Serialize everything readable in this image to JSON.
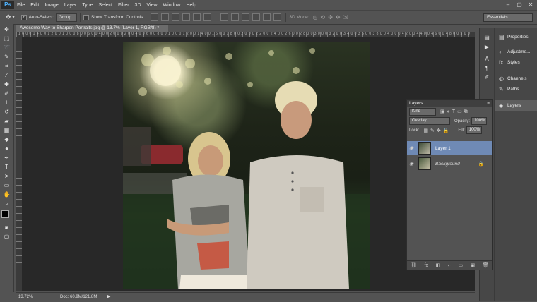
{
  "app": {
    "logo": "Ps"
  },
  "menu": [
    "File",
    "Edit",
    "Image",
    "Layer",
    "Type",
    "Select",
    "Filter",
    "3D",
    "View",
    "Window",
    "Help"
  ],
  "window_controls": [
    "–",
    "▢",
    "✕"
  ],
  "options": {
    "auto_select_label": "Auto-Select:",
    "auto_select_value": "Group",
    "transform_label": "Show Transform Controls",
    "mode_label": "3D Mode:",
    "workspace": "Essentials"
  },
  "document": {
    "tab_title": "Awesome Way to Sharpen Portraits.jpg @ 13.7% (Layer 1, RGB/8) *",
    "ruler_numbers": "1 6 0 0  1 4 0 0  1 2 0 0  1 0 0 0  8 0 0  6 0 0  4 0 0  2 0 0  0  2 0 0  4 0 0  6 0 0  8 0 0  1 0 0 0  1 2 0 0  1 4 0 0  1 6 0 0  1 8 0 0  2 0 0 0  2 2 0 0  2 4 0 0  2 6 0 0  2 8 0 0  3 0 0 0  3 2 0 0  3 4 0 0  3 6 0 0  3 8 0 0  4 0 0 0  4 2 0 0  4 4 0 0  4 6 0 0  4 8 0 0  5 0 0 0  5 2 0 0  5 4 0 0  5 6 0 0  5 8 0 0  6 0 0 0"
  },
  "status": {
    "zoom": "13.72%",
    "doc": "Doc: 60.9M/121.8M"
  },
  "right_panels": [
    {
      "icon": "properties-icon",
      "glyph": "▤",
      "label": "Properties"
    },
    {
      "icon": "adjustments-icon",
      "glyph": "◐",
      "label": "Adjustme..."
    },
    {
      "icon": "styles-icon",
      "glyph": "fx",
      "label": "Styles"
    },
    {
      "icon": "channels-icon",
      "glyph": "◎",
      "label": "Channels"
    },
    {
      "icon": "paths-icon",
      "glyph": "✎",
      "label": "Paths"
    },
    {
      "icon": "layers-icon",
      "glyph": "◈",
      "label": "Layers"
    }
  ],
  "layers_panel": {
    "title": "Layers",
    "kind_label": "Kind",
    "blend_mode": "Overlay",
    "opacity_label": "Opacity:",
    "opacity_value": "100%",
    "lock_label": "Lock:",
    "fill_label": "Fill:",
    "fill_value": "100%",
    "layers": [
      {
        "name": "Layer 1",
        "selected": true
      },
      {
        "name": "Background",
        "selected": false,
        "locked": true
      }
    ],
    "bottom_icons": [
      "⛓",
      "fx",
      "◧",
      "◐",
      "▭",
      "▣",
      "🗑"
    ]
  },
  "colors": {
    "accent_selected": "#6f8ab5",
    "panel_bg": "#535353",
    "canvas_bg": "#282828"
  }
}
